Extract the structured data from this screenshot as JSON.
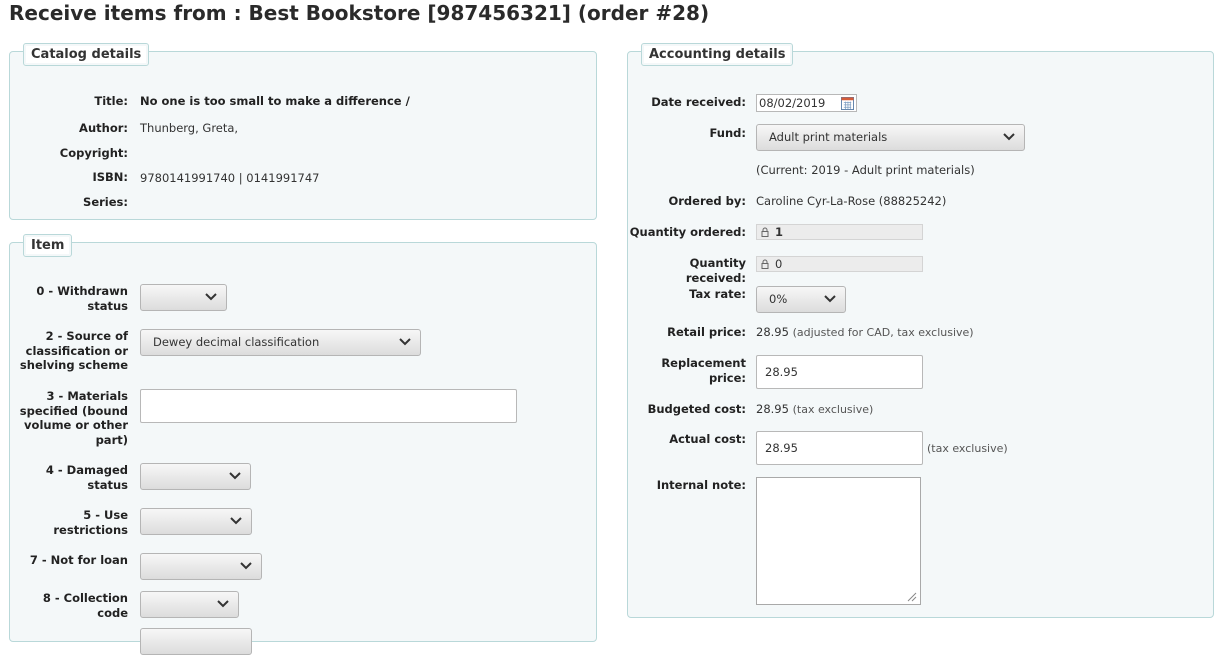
{
  "page": {
    "title": "Receive items from : Best Bookstore [987456321] (order #28)"
  },
  "catalog": {
    "legend": "Catalog details",
    "fields": [
      {
        "label": "Title:",
        "value": "No one is too small to make a difference /"
      },
      {
        "label": "Author:",
        "value": "Thunberg, Greta,"
      },
      {
        "label": "Copyright:",
        "value": ""
      },
      {
        "label": "ISBN:",
        "value": "9780141991740 | 0141991747"
      },
      {
        "label": "Series:",
        "value": ""
      }
    ]
  },
  "item": {
    "legend": "Item",
    "fields": [
      {
        "label": "0 - Withdrawn status",
        "value": ""
      },
      {
        "label": "2 - Source of classification or shelving scheme",
        "value": "Dewey decimal classification"
      },
      {
        "label": "3 - Materials specified (bound volume or other part)",
        "value": ""
      },
      {
        "label": "4 - Damaged status",
        "value": ""
      },
      {
        "label": "5 - Use restrictions",
        "value": ""
      },
      {
        "label": "7 - Not for loan",
        "value": ""
      },
      {
        "label": "8 - Collection code",
        "value": ""
      }
    ]
  },
  "accounting": {
    "legend": "Accounting details",
    "date_received": {
      "label": "Date received:",
      "value": "08/02/2019"
    },
    "fund": {
      "label": "Fund:",
      "value": "Adult print materials",
      "current": "(Current: 2019 - Adult print materials)"
    },
    "ordered_by": {
      "label": "Ordered by:",
      "value": "Caroline Cyr-La-Rose (88825242)"
    },
    "quantity_ordered": {
      "label": "Quantity ordered:",
      "value": "1"
    },
    "quantity_received": {
      "label": "Quantity received:",
      "value": "0"
    },
    "tax_rate": {
      "label": "Tax rate:",
      "value": "0%"
    },
    "retail_price": {
      "label": "Retail price:",
      "value": "28.95",
      "note": "(adjusted for CAD, tax exclusive)"
    },
    "replacement_price": {
      "label": "Replacement price:",
      "value": "28.95"
    },
    "budgeted_cost": {
      "label": "Budgeted cost:",
      "value": "28.95",
      "note": "(tax exclusive)"
    },
    "actual_cost": {
      "label": "Actual cost:",
      "value": "28.95",
      "note": "(tax exclusive)"
    },
    "internal_note": {
      "label": "Internal note:",
      "value": ""
    }
  },
  "icons": {
    "calendar": "calendar-icon",
    "chevron": "chevron-down-icon",
    "lock": "lock-icon",
    "resize": "resize-grip-icon"
  }
}
